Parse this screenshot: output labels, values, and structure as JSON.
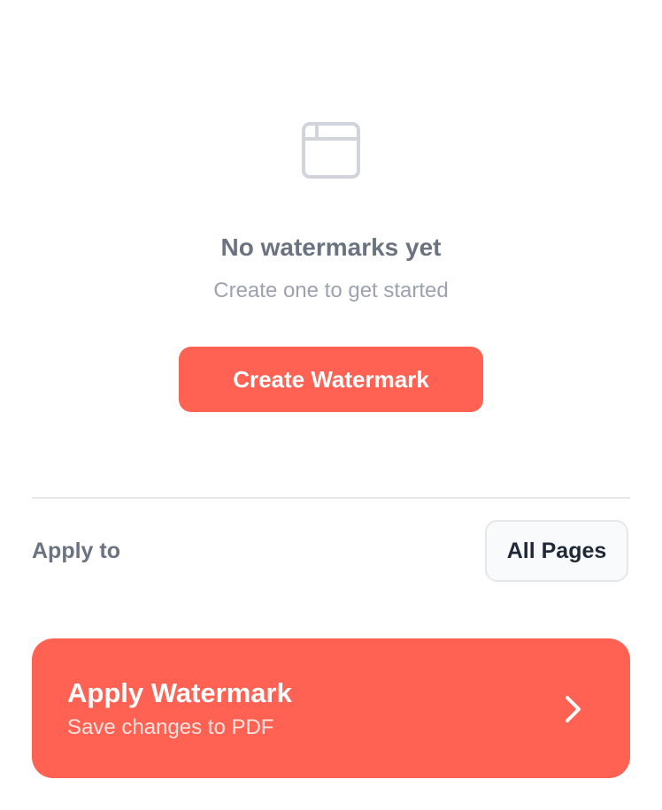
{
  "empty_state": {
    "icon": "browser-window-icon",
    "title": "No watermarks yet",
    "subtitle": "Create one to get started",
    "create_button_label": "Create Watermark"
  },
  "apply_to": {
    "label": "Apply to",
    "selected_value": "All Pages"
  },
  "apply_button": {
    "title": "Apply Watermark",
    "subtitle": "Save changes to PDF",
    "icon": "chevron-right-icon"
  },
  "colors": {
    "accent": "#ff6153",
    "muted_text": "#6b7280",
    "light_text": "#9ca3af",
    "divider": "#e5e7eb"
  }
}
